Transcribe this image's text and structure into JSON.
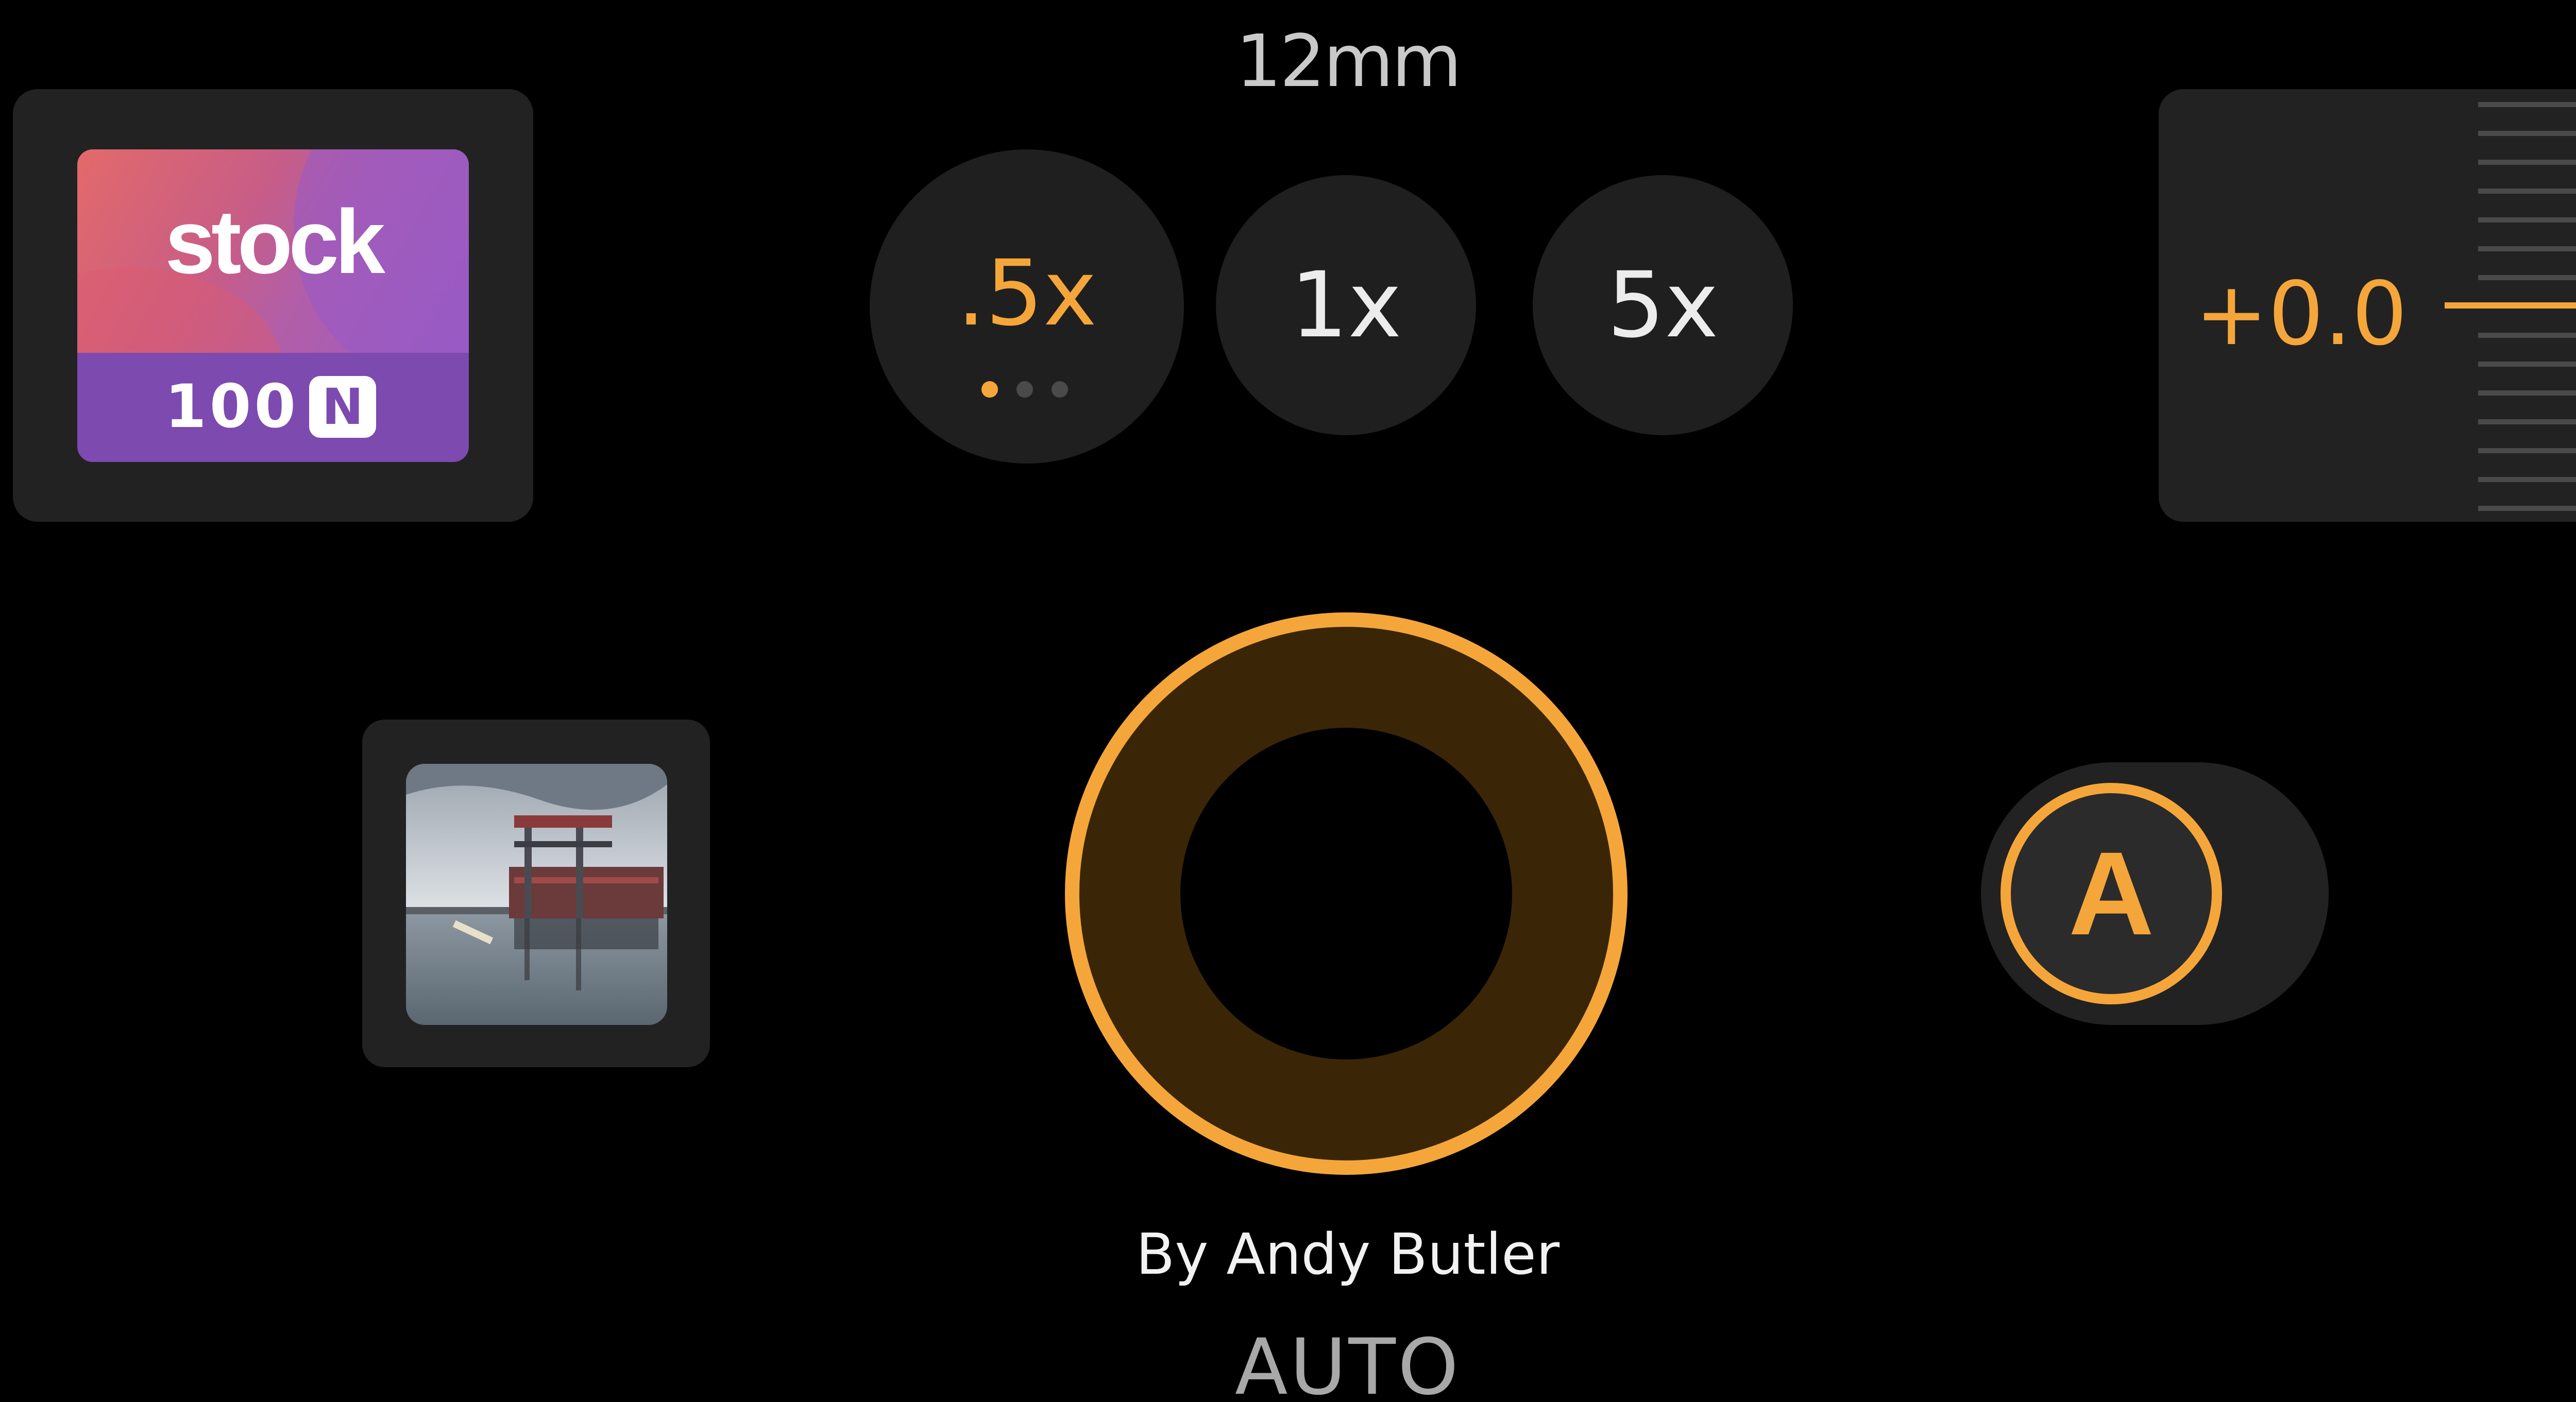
{
  "focal_length": "12mm",
  "film": {
    "brand": "stock",
    "iso": "100",
    "type_badge": "N",
    "colors": {
      "top_gradient": "#c85d86",
      "bottom": "#7d4ab0"
    }
  },
  "zoom": {
    "options": [
      {
        "label": ".5x",
        "selected": true
      },
      {
        "label": "1x",
        "selected": false
      },
      {
        "label": "5x",
        "selected": false
      }
    ],
    "page_dots": 3,
    "active_dot": 1
  },
  "exposure": {
    "value": "+0.0"
  },
  "gallery": {
    "thumbnail_icon": "last-photo-thumbnail"
  },
  "shutter": {
    "icon": "shutter-button-icon"
  },
  "auto_toggle": {
    "label": "A"
  },
  "credit": "By Andy Butler",
  "mode": "AUTO",
  "colors": {
    "accent": "#f5a63a",
    "panel": "#222222",
    "background": "#000000"
  }
}
